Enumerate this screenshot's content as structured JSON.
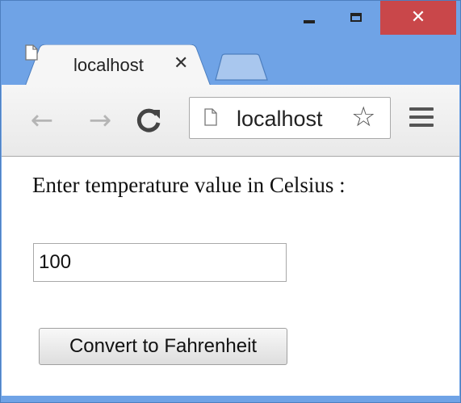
{
  "window": {
    "controls": {
      "minimize_icon": "minimize-icon",
      "maximize_icon": "maximize-icon",
      "close_glyph": "✕"
    },
    "frame_color": "#6fa3e6",
    "close_color": "#c9474a"
  },
  "tabs": [
    {
      "title": "localhost",
      "close_glyph": "✕",
      "active": true
    }
  ],
  "toolbar": {
    "back_glyph": "←",
    "forward_glyph": "→",
    "reload_glyph": "C",
    "url": "localhost",
    "bookmark_glyph": "☆"
  },
  "page": {
    "prompt": "Enter temperature value in Celsius :",
    "input_value": "100",
    "convert_label": "Convert to Fahrenheit"
  }
}
